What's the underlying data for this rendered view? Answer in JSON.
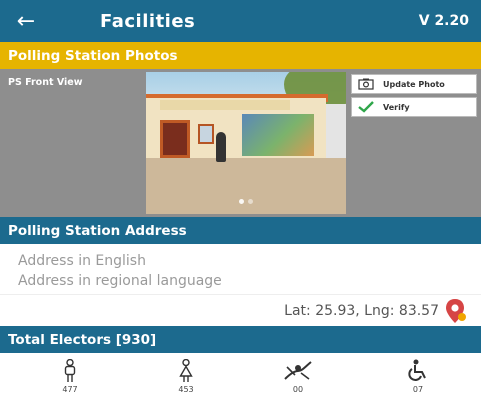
{
  "appbar": {
    "title": "Facilities",
    "version": "V 2.20",
    "back_icon": "arrow-left-icon"
  },
  "photos": {
    "section_title": "Polling Station Photos",
    "view_label": "PS Front View",
    "update_button_label": "Update Photo",
    "verify_button_label": "Verify",
    "slide_index": 1,
    "slide_count": 2
  },
  "address": {
    "section_title": "Polling Station Address",
    "english_placeholder": "Address in English",
    "regional_placeholder": "Address in regional language",
    "coordinates": "Lat: 25.93, Lng: 83.57",
    "location_icon": "map-pin-icon"
  },
  "electors": {
    "section_title": "Total Electors [930]",
    "stats": [
      {
        "icon": "male-voter-icon",
        "value": "477"
      },
      {
        "icon": "female-voter-icon",
        "value": "453"
      },
      {
        "icon": "third-gender-icon",
        "value": "00"
      },
      {
        "icon": "wheelchair-icon",
        "value": "07"
      }
    ]
  },
  "colors": {
    "primary": "#1c6a8e",
    "accent": "#e6b400",
    "verify_check": "#2fa64a",
    "pin": "#d64545"
  }
}
